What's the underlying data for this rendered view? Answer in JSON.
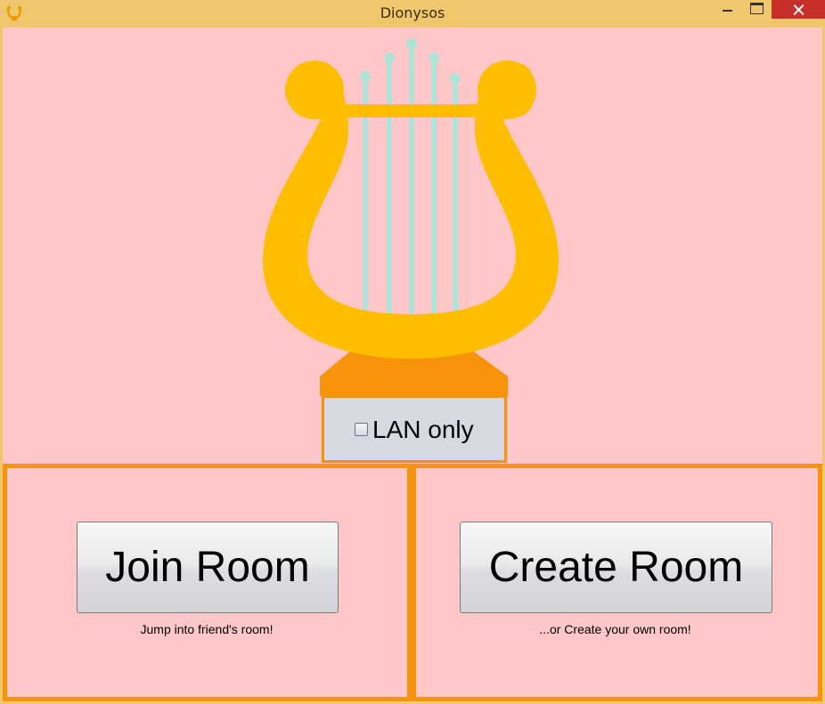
{
  "window": {
    "title": "Dionysos",
    "app_icon": "lyre-icon",
    "controls": [
      "minimize-icon",
      "maximize-icon",
      "close-icon"
    ]
  },
  "colors": {
    "background": "#ffc7c7",
    "accent": "#f7930a",
    "lyre": "#ffbd00",
    "strings": "#aee3d8",
    "titlebar": "#f0c76c"
  },
  "illustration": {
    "icon": "lyre-icon"
  },
  "lan_option": {
    "label": "LAN only",
    "checked": false
  },
  "join": {
    "label": "Join Room",
    "caption": "Jump into friend's room!"
  },
  "create": {
    "label": "Create Room",
    "caption": "...or Create your own room!"
  }
}
